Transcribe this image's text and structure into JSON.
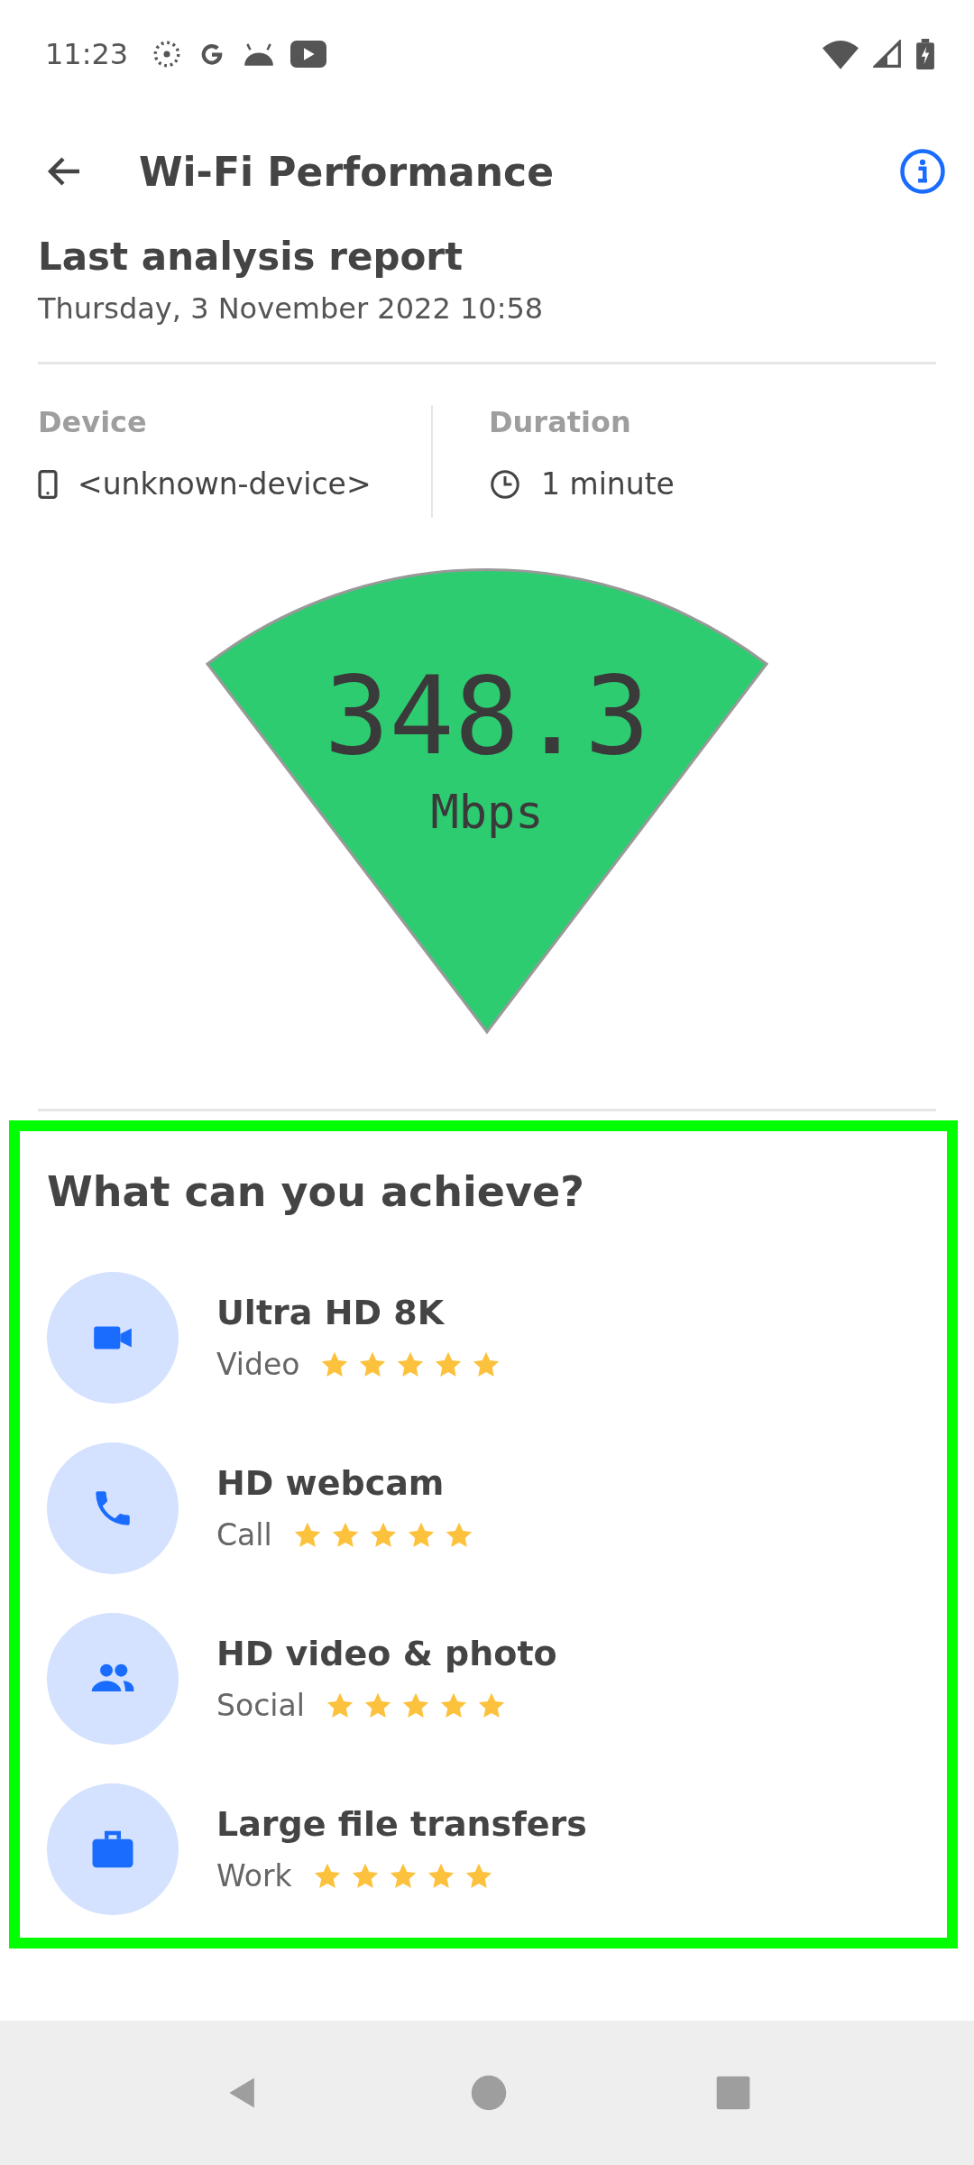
{
  "status_bar": {
    "time": "11:23"
  },
  "app_bar": {
    "title": "Wi-Fi Performance"
  },
  "report": {
    "heading": "Last analysis report",
    "date": "Thursday, 3 November 2022 10:58"
  },
  "details": [
    {
      "label": "Device",
      "value": "<unknown-device>",
      "kind": "device"
    },
    {
      "label": "Duration",
      "value": "1 minute",
      "kind": "time"
    }
  ],
  "speed": {
    "value": "348.3",
    "unit": "Mbps"
  },
  "achieve": {
    "heading": "What can you achieve?",
    "items": [
      {
        "title": "Ultra HD 8K",
        "category": "Video",
        "stars": 5,
        "kind": "video"
      },
      {
        "title": "HD webcam",
        "category": "Call",
        "stars": 5,
        "kind": "call"
      },
      {
        "title": "HD video & photo",
        "category": "Social",
        "stars": 5,
        "kind": "social"
      },
      {
        "title": "Large file transfers",
        "category": "Work",
        "stars": 5,
        "kind": "work"
      }
    ]
  }
}
